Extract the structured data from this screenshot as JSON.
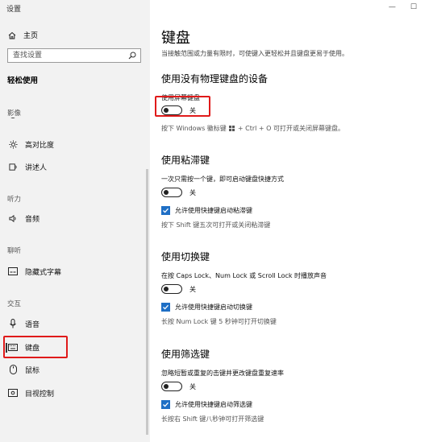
{
  "window": {
    "title": "设置",
    "minimize_glyph": "—",
    "maximize_glyph": "☐"
  },
  "sidebar": {
    "home_label": "主页",
    "search_placeholder": "查找设置",
    "section_title": "轻松使用",
    "categories": [
      "影像",
      "听力",
      "聊听",
      "交互"
    ],
    "items": [
      {
        "label": "高对比度",
        "icon": "sun-icon"
      },
      {
        "label": "讲述人",
        "icon": "narrator-icon"
      },
      {
        "label": "音频",
        "icon": "speaker-icon"
      },
      {
        "label": "隐藏式字幕",
        "icon": "caption-icon"
      },
      {
        "label": "语音",
        "icon": "microphone-icon"
      },
      {
        "label": "键盘",
        "icon": "keyboard-icon",
        "selected": true
      },
      {
        "label": "鼠标",
        "icon": "mouse-icon"
      },
      {
        "label": "目视控制",
        "icon": "eye-control-icon"
      }
    ]
  },
  "main": {
    "title": "键盘",
    "description": "当接触范围或力量有限时，可使键入更轻松并且键盘更易于使用。",
    "sections": [
      {
        "heading": "使用没有物理键盘的设备",
        "setting_label": "使用屏幕键盘",
        "toggle_state": "关",
        "hint_pre": "按下 Windows 徽标键",
        "hint_post": "+ Ctrl + O 可打开或关闭屏幕键盘。"
      },
      {
        "heading": "使用粘滞键",
        "setting_label": "一次只需按一个键，即可启动键盘快捷方式",
        "toggle_state": "关",
        "checkbox_label": "允许使用快捷键启动粘滞键",
        "hint": "按下 Shift 键五次可打开或关闭粘滞键"
      },
      {
        "heading": "使用切换键",
        "setting_label": "在按 Caps Lock、Num Lock 或 Scroll Lock 时播放声音",
        "toggle_state": "关",
        "checkbox_label": "允许使用快捷键启动切换键",
        "hint": "长按 Num Lock 键 5 秒钟可打开切换键"
      },
      {
        "heading": "使用筛选键",
        "setting_label": "忽略短暂或重复的击键并更改键盘重复速率",
        "toggle_state": "关",
        "checkbox_label": "允许使用快捷键启动筛选键",
        "hint": "长按右 Shift 键八秒钟可打开筛选键"
      }
    ]
  },
  "colors": {
    "accent": "#1f6fc5",
    "highlight": "#e01a1a",
    "sidebar_bg": "#f2f2f2"
  }
}
